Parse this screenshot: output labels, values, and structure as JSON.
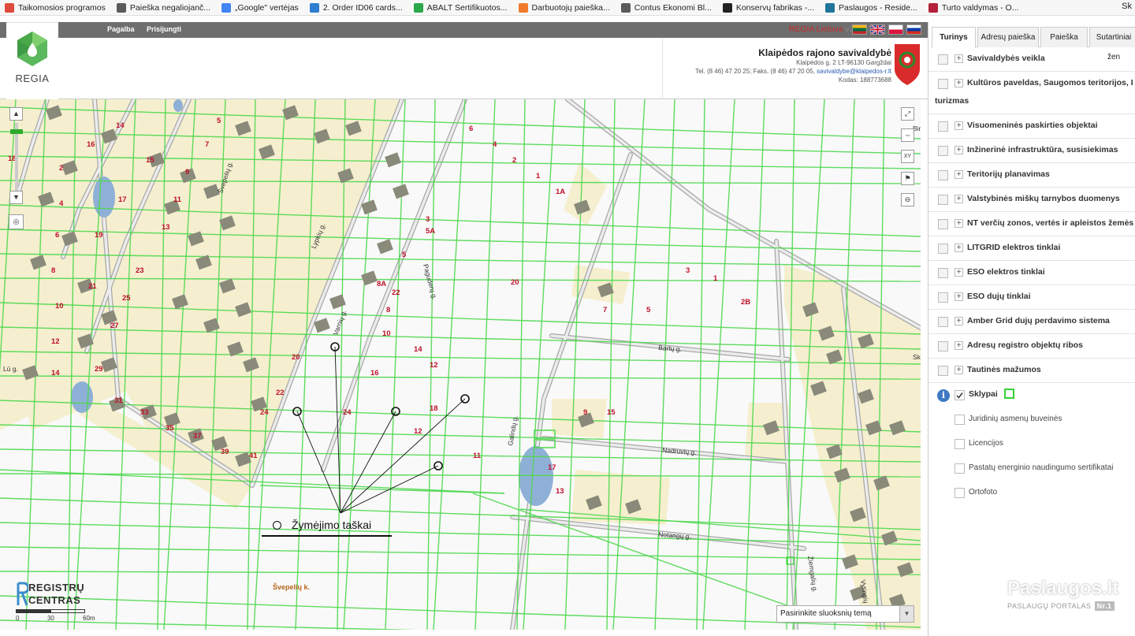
{
  "bookmarks": [
    {
      "label": "Taikomosios programos",
      "icon": "apps-icon",
      "color": "#e04a3c"
    },
    {
      "label": "Paieška negaliojanč...",
      "icon": "globe-icon",
      "color": "#5a5a5a"
    },
    {
      "label": "„Google\" vertėjas",
      "icon": "translate-icon",
      "color": "#4285f4"
    },
    {
      "label": "2. Order ID06 cards...",
      "icon": "n-icon",
      "color": "#2d7dd2"
    },
    {
      "label": "ABALT Sertifikuotos...",
      "icon": "abalt-icon",
      "color": "#2aa84a"
    },
    {
      "label": "Darbuotojų paieška...",
      "icon": "box-icon",
      "color": "#f07b2b"
    },
    {
      "label": "Contus Ekonomi Bl...",
      "icon": "globe-icon",
      "color": "#5a5a5a"
    },
    {
      "label": "Konservų fabrikas -...",
      "icon": "a-icon",
      "color": "#222222"
    },
    {
      "label": "Paslaugos - Reside...",
      "icon": "wordpress-icon",
      "color": "#21759b"
    },
    {
      "label": "Turto valdymas - O...",
      "icon": "shield-icon",
      "color": "#b5213a"
    }
  ],
  "bookmarks_more": "Sk",
  "header": {
    "logo_text": "REGIA",
    "nav": [
      "Pagalba",
      "Prisijungti"
    ],
    "version_name": "REGIA Lietuva",
    "version_num": "v3 17 1",
    "municipality": {
      "name": "Klaipėdos rajono savivaldybė",
      "address": "Klaipėdos g. 2 LT-96130 Gargždai",
      "phone": "Tel. (8 46) 47 20 25; Faks. (8 46) 47 20 05,",
      "email": "savivaldybe@klaipedos-r.lt",
      "code": "Kodas: 188773688"
    }
  },
  "map": {
    "legend_label": "Žymėjimo taškai",
    "place_label": "Švepelių k.",
    "brand_line1": "REGISTRŲ",
    "brand_line2": "CENTRAS",
    "scale_labels": [
      "0",
      "30",
      "60m"
    ],
    "layer_select_placeholder": "Pasirinkite sluoksnių temą",
    "streets": [
      "Švepelių g.",
      "Lypkių g.",
      "Varnių g.",
      "Paguderų g.",
      "Galindų g.",
      "Bartų g.",
      "Nadruvių g.",
      "Notangų g.",
      "Žiemgalių g.",
      "Vytingių g.",
      "Lū g.",
      "Bir",
      "Sk"
    ],
    "parcel_numbers": [
      "14",
      "16",
      "15",
      "18",
      "2",
      "4",
      "6",
      "8",
      "10",
      "12",
      "14",
      "29",
      "31",
      "33",
      "35",
      "37",
      "39",
      "41",
      "19",
      "21",
      "23",
      "25",
      "27",
      "17",
      "11",
      "13",
      "9",
      "7",
      "5",
      "22",
      "24",
      "20",
      "16",
      "18",
      "12",
      "14",
      "10",
      "8",
      "6",
      "4",
      "2",
      "1",
      "1A",
      "3",
      "5A",
      "5",
      "8A",
      "22",
      "20",
      "24",
      "12",
      "11",
      "13",
      "17",
      "15",
      "9",
      "7",
      "5",
      "3",
      "1",
      "2B"
    ]
  },
  "panel": {
    "tabs": [
      "Turinys",
      "Adresų paieška",
      "Paieška",
      "Sutartiniai žen"
    ],
    "active_tab": 0,
    "layers": [
      {
        "label": "Savivaldybės veikla"
      },
      {
        "label": "Kultūros paveldas, Saugomos teritorijos, I",
        "label2": "turizmas"
      },
      {
        "label": "Visuomeninės paskirties objektai"
      },
      {
        "label": "Inžinerinė infrastruktūra, susisiekimas"
      },
      {
        "label": "Teritorijų planavimas"
      },
      {
        "label": "Valstybinės miškų tarnybos duomenys"
      },
      {
        "label": "NT verčių zonos, vertės ir apleistos žemės"
      },
      {
        "label": "LITGRID elektros tinklai"
      },
      {
        "label": "ESO elektros tinklai"
      },
      {
        "label": "ESO dujų tinklai"
      },
      {
        "label": "Amber Grid dujų perdavimo sistema"
      },
      {
        "label": "Adresų registro objektų ribos"
      },
      {
        "label": "Tautinės mažumos"
      }
    ],
    "sklypai_label": "Sklypai",
    "sklypai_checked": true,
    "sublayers": [
      "Juridinių asmenų buveinės",
      "Licencijos",
      "Pastatų energinio naudingumo sertifikatai",
      "Ortofoto"
    ]
  },
  "watermark": {
    "title": "Paslaugos.lt",
    "subtitle": "PASLAUGŲ PORTALAS",
    "badge": "Nr.1"
  },
  "colors": {
    "parcel_line": "#4ed84e",
    "parcel_fill": "#f5efcf",
    "building": "#8a8a7a",
    "road": "#a8a8a8",
    "parcel_number": "#c0102a",
    "water": "#8fb0d6"
  }
}
